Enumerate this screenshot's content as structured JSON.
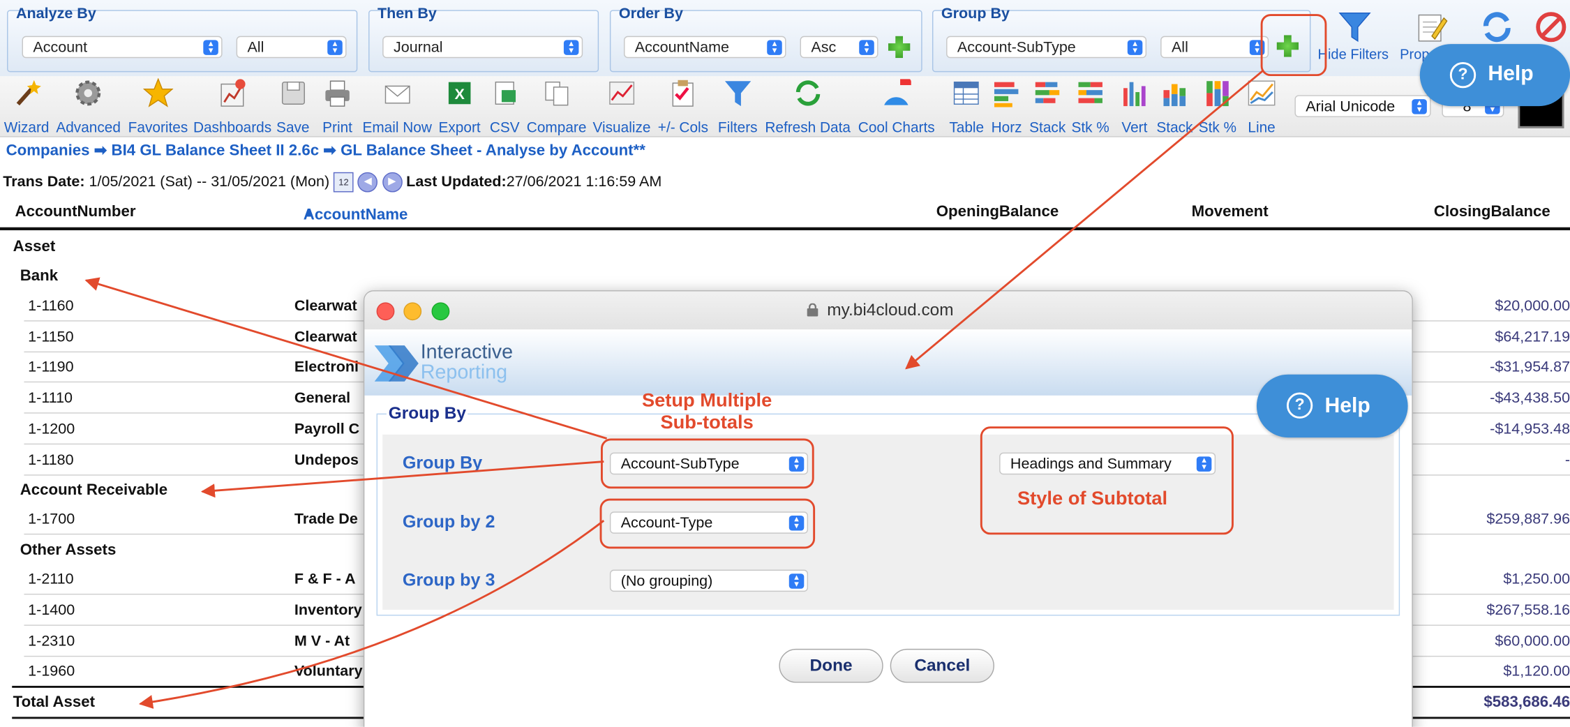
{
  "filters": {
    "analyze_by": {
      "title": "Analyze By",
      "value": "Account",
      "scope": "All"
    },
    "then_by": {
      "title": "Then By",
      "value": "Journal"
    },
    "order_by": {
      "title": "Order By",
      "value": "AccountName",
      "direction": "Asc"
    },
    "group_by": {
      "title": "Group By",
      "value": "Account-SubType",
      "scope": "All"
    },
    "hide_filters_label": "Hide Filters",
    "properties_label": "Prop"
  },
  "toolbar": {
    "items": [
      "Wizard",
      "Advanced",
      "Favorites",
      "Dashboards",
      "Save",
      "Print",
      "Email Now",
      "Export",
      "CSV",
      "Compare",
      "Visualize",
      "+/- Cols",
      "Filters",
      "Refresh Data",
      "Cool Charts"
    ],
    "chart_items": [
      "Table",
      "Horz",
      "Stack",
      "Stk %",
      "Vert",
      "Stack",
      "Stk %",
      "Line"
    ],
    "font": "Arial Unicode",
    "font_size": "8"
  },
  "help_label": "Help",
  "breadcrumb": {
    "companies": "Companies",
    "sep": "➡",
    "report": "BI4 GL Balance Sheet II 2.6c",
    "view": "GL Balance Sheet - Analyse by Account**"
  },
  "trans": {
    "label": "Trans Date:",
    "range": "1/05/2021 (Sat) -- 31/05/2021 (Mon)",
    "updated_label": "Last Updated:",
    "updated": "27/06/2021 1:16:59 AM"
  },
  "table": {
    "headers": [
      "AccountNumber",
      "AccountName",
      "OpeningBalance",
      "Movement",
      "ClosingBalance"
    ],
    "group": "Asset",
    "subgroups": [
      "Bank",
      "Account Receivable",
      "Other Assets"
    ],
    "rows": [
      {
        "num": "1-1160",
        "name": "Clearwat",
        "closing": "$20,000.00"
      },
      {
        "num": "1-1150",
        "name": "Clearwat",
        "closing": "$64,217.19"
      },
      {
        "num": "1-1190",
        "name": "Electroni",
        "closing": "-$31,954.87"
      },
      {
        "num": "1-1110",
        "name": "General",
        "closing": "-$43,438.50"
      },
      {
        "num": "1-1200",
        "name": "Payroll C",
        "closing": "-$14,953.48"
      },
      {
        "num": "1-1180",
        "name": "Undepos",
        "closing": "-"
      },
      {
        "num": "1-1700",
        "name": "Trade De",
        "closing": "$259,887.96"
      },
      {
        "num": "1-2110",
        "name": "F & F - A",
        "closing": "$1,250.00"
      },
      {
        "num": "1-1400",
        "name": "Inventory",
        "closing": "$267,558.16"
      },
      {
        "num": "1-2310",
        "name": "M V - At",
        "closing": "$60,000.00"
      },
      {
        "num": "1-1960",
        "name": "Voluntary",
        "closing": "$1,120.00"
      }
    ],
    "total_label": "Total Asset",
    "total_value": "$583,686.46"
  },
  "modal": {
    "url": "my.bi4cloud.com",
    "logo_line1": "Interactive",
    "logo_line2": "Reporting",
    "section": "Group By",
    "label1": "Group By",
    "value1": "Account-SubType",
    "label2": "Group by 2",
    "value2": "Account-Type",
    "label3": "Group by 3",
    "value3": "(No grouping)",
    "style_value": "Headings and Summary",
    "done": "Done",
    "cancel": "Cancel"
  },
  "annotations": {
    "setup_line1": "Setup Multiple",
    "setup_line2": "Sub-totals",
    "style": "Style of Subtotal"
  }
}
